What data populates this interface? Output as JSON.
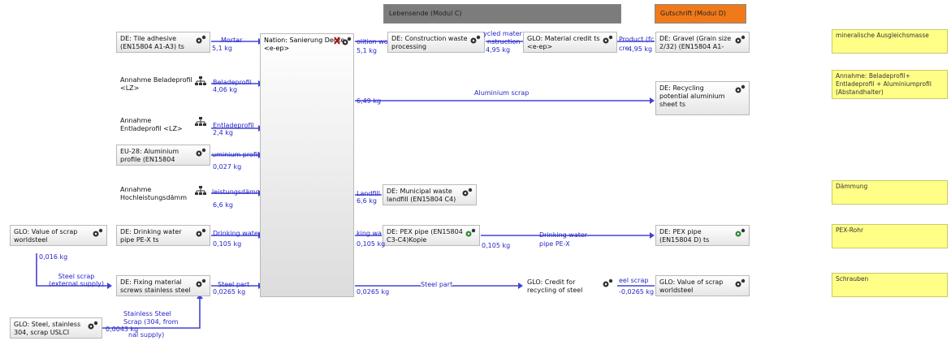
{
  "headers": {
    "end_of_life": "Lebensende (Modul C)",
    "credit": "Gutschrift (Modul D)"
  },
  "colors": {
    "flow_line": "#4343d6",
    "flow_text": "#2626c9",
    "end_of_life_header": "#7c7c7c",
    "credit_header": "#f07a1a",
    "note_bg": "#ffff88"
  },
  "center_process": {
    "label": "Nation: Sanierung Decke <e-ep>",
    "icon": "cross-gear-icon"
  },
  "left_processes": [
    {
      "label": "DE: Tile adhesive (EN15804 A1-A3) ts",
      "icon": "gears-icon"
    },
    {
      "label": "Annahme Beladeprofil <LZ>",
      "icon": "network-icon"
    },
    {
      "label": "Annahme Entladeprofil <LZ>",
      "icon": "network-icon"
    },
    {
      "label": "EU-28: Aluminium profile (EN15804",
      "icon": "gears-icon"
    },
    {
      "label": "Annahme Hochleistungsdämm",
      "icon": "network-icon"
    },
    {
      "label": "DE: Drinking water pipe PE-X ts",
      "icon": "gears-icon"
    },
    {
      "label": "DE: Fixing material screws stainless steel",
      "icon": "gears-icon"
    }
  ],
  "supply_processes": [
    {
      "label": "GLO: Value of scrap worldsteel",
      "icon": "gears-icon"
    },
    {
      "label": "GLO: Steel, stainless 304, scrap USLCI",
      "icon": "gears-icon"
    }
  ],
  "input_flows": [
    {
      "label": "Mortar",
      "amount": "5,1 kg"
    },
    {
      "label": "Beladeprofil",
      "amount": "4,06 kg"
    },
    {
      "label": "Entladeprofil",
      "amount": "2,4 kg"
    },
    {
      "label": "uminium profil",
      "amount": "0,027 kg"
    },
    {
      "label": "leistungsdämn",
      "amount": "6,6 kg"
    },
    {
      "label": "Drinking water",
      "amount": "0,105 kg"
    },
    {
      "label": "Steel part",
      "amount": "0,0265 kg"
    }
  ],
  "supply_flows": {
    "scrap_amount": "0,016 kg",
    "steel_scrap_label": "Steel scrap (external supply)",
    "stainless_amount": "0,0043 kg",
    "stainless_label_1": "Stainless Steel",
    "stainless_label_2": "Scrap (304, from",
    "stainless_label_3": "nal supply)"
  },
  "eol_processes": [
    {
      "label": "DE: Construction waste processing",
      "icon": "gears-icon"
    },
    {
      "label": "GLO: Material credit ts <e-ep>",
      "icon": "gears-icon"
    },
    {
      "label": "DE: Municipal waste landfill (EN15804 C4)",
      "icon": "gears-icon"
    },
    {
      "label": "DE: PEX pipe (EN15804 C3-C4)Kopie",
      "icon": "gears-green-icon"
    },
    {
      "label": "GLO: Credit for recycling of steel",
      "icon": "gears-icon"
    }
  ],
  "credit_processes": [
    {
      "label": "DE: Gravel (Grain size 2/32) (EN15804 A1-A3)",
      "icon": "gears-icon"
    },
    {
      "label": "DE: Recycling potential aluminium sheet ts",
      "icon": "gears-icon"
    },
    {
      "label": "DE: PEX pipe (EN15804 D) ts",
      "icon": "gears-green-icon"
    },
    {
      "label": "GLO: Value of scrap worldsteel",
      "icon": "gears-icon"
    }
  ],
  "eol_flows": {
    "demolition_label": "olition wo",
    "demolition_amount": "5,1 kg",
    "recycled_label_1": "ycled mater",
    "recycled_label_2": "nstruction",
    "recycled_amount": "4,95 kg",
    "product_label_1": "Product (fc",
    "product_label_2": "cre",
    "product_amount": "4,95 kg",
    "aluminium_amount": "6,49 kg",
    "aluminium_label": "Aluminium scrap",
    "landfill_label": "Landfill",
    "landfill_amount": "6,6 kg",
    "drinking_in_label": "king wa",
    "drinking_in_amount": "0,105 kg",
    "drinking_out_amount": "0,105 kg",
    "drinking_out_label_1": "Drinking water",
    "drinking_out_label_2": "pipe PE-X",
    "steel_amount": "0,0265 kg",
    "steel_label": "Steel part",
    "eel_scrap_label": "eel scrap",
    "eel_scrap_amount": "-0,0265 kg"
  },
  "notes": [
    {
      "text": "mineralische Ausgleichsmasse"
    },
    {
      "text": "Annahme: Beladeprofil+ Entladeprofil + Aluminiumprofil (Abstandhalter)"
    },
    {
      "text": "Dämmung"
    },
    {
      "text": "PEX-Rohr"
    },
    {
      "text": "Schrauben"
    }
  ]
}
